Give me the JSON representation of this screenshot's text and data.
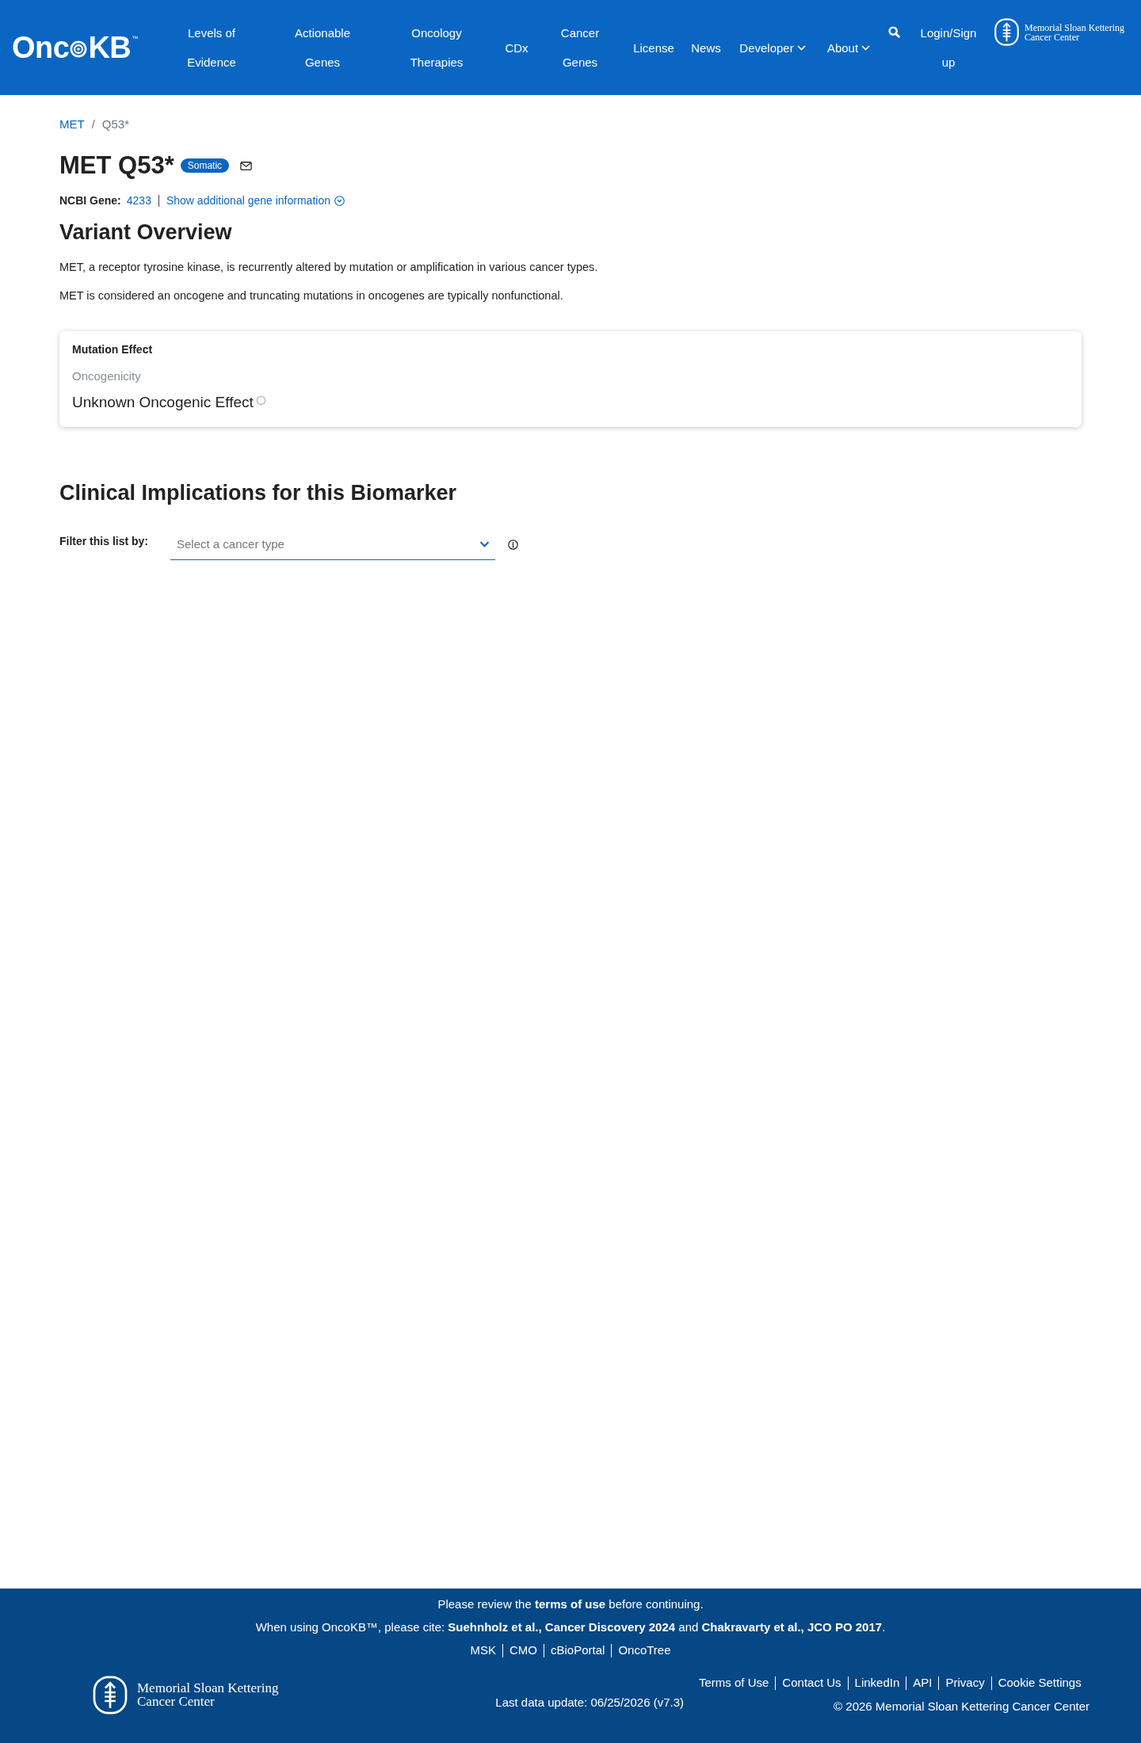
{
  "header": {
    "logo": {
      "text_start": "Onc",
      "text_end": "KB",
      "trademark": "™"
    },
    "nav": [
      {
        "label": "Levels of Evidence",
        "kind": "link"
      },
      {
        "label": "Actionable Genes",
        "kind": "link"
      },
      {
        "label": "Oncology Therapies",
        "kind": "link"
      },
      {
        "label": "CDx",
        "kind": "link"
      },
      {
        "label": "Cancer Genes",
        "kind": "link"
      },
      {
        "label": "License",
        "kind": "link"
      },
      {
        "label": "News",
        "kind": "link"
      },
      {
        "label": "Developer",
        "kind": "dropdown"
      },
      {
        "label": "About",
        "kind": "dropdown"
      }
    ],
    "login": "Login/Sign up",
    "partner_logo": "Memorial Sloan Kettering Cancer Center"
  },
  "breadcrumb": {
    "separator": "/",
    "items": [
      {
        "label": "MET",
        "kind": "link"
      },
      {
        "label": "Q53*",
        "kind": "current"
      }
    ]
  },
  "variant": {
    "title": "MET Q53*",
    "badge": "Somatic"
  },
  "gene_info": {
    "label": "NCBI Gene:",
    "gene_id": "4233",
    "toggle": "Show additional gene information",
    "expanded": false
  },
  "overview": {
    "heading": "Variant Overview",
    "paragraphs": [
      "MET, a receptor tyrosine kinase, is recurrently altered by mutation or amplification in various cancer types.",
      "MET is considered an oncogene and truncating mutations in oncogenes are typically nonfunctional."
    ]
  },
  "mutation_effect": {
    "title": "Mutation Effect",
    "label": "Oncogenicity",
    "value": "Unknown Oncogenic Effect"
  },
  "clinical": {
    "heading": "Clinical Implications for this Biomarker",
    "filter_label": "Filter this list by:",
    "select": {
      "placeholder": "Select a cancer type"
    }
  },
  "footer": {
    "notice": "Please review the **terms of use** before continuing.",
    "citation": "When using OncoKB™, please cite: **Suehnholz et al., Cancer Discovery 2024** and **Chakravarty et al., JCO PO 2017**.",
    "links": [
      "MSK",
      "CMO",
      "cBioPortal",
      "OncoTree"
    ],
    "logo": "Memorial Sloan Kettering Cancer Center",
    "last_update": "Last data update: 06/25/2026 (v7.3)",
    "legal_links": [
      "Terms of Use",
      "Contact Us",
      "LinkedIn",
      "API",
      "Privacy",
      "Cookie Settings"
    ],
    "copyright": "© 2026 Memorial Sloan Kettering Cancer Center"
  }
}
